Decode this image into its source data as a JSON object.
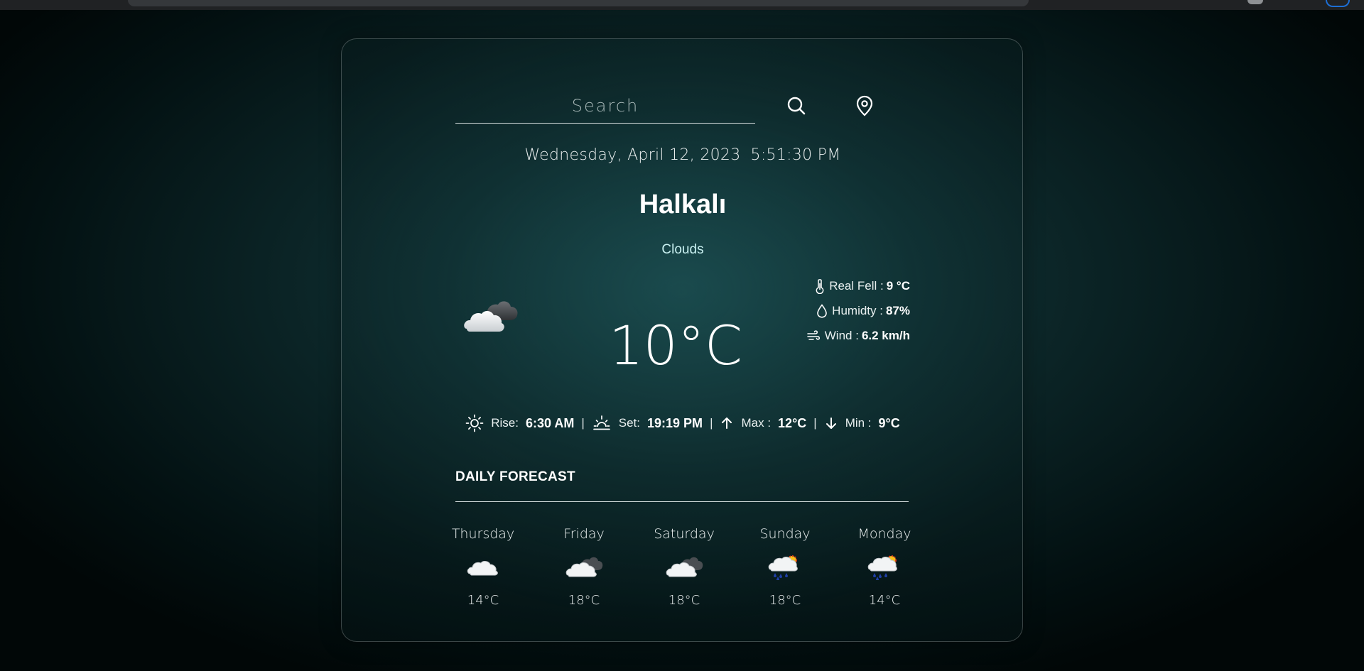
{
  "search": {
    "placeholder": "Search"
  },
  "datetime": {
    "date": "Wednesday, April 12, 2023",
    "time": "5:51:30 PM"
  },
  "location": {
    "city": "Halkalı"
  },
  "current": {
    "condition": "Clouds",
    "icon": "clouds-icon",
    "temperature": "10°C",
    "real_feel_label": "Real Fell :",
    "real_feel_value": "9 °C",
    "humidity_label": "Humidty :",
    "humidity_value": "87%",
    "wind_label": "Wind :",
    "wind_value": "6.2 km/h"
  },
  "sun": {
    "rise_label": "Rise:",
    "rise_value": "6:30 AM",
    "set_label": "Set:",
    "set_value": "19:19 PM",
    "max_label": "Max :",
    "max_value": "12°C",
    "min_label": "Min :",
    "min_value": "9°C",
    "separator": "|"
  },
  "forecast": {
    "title": "DAILY FORECAST",
    "days": [
      {
        "name": "Thursday",
        "temp": "14°C",
        "icon": "few-clouds-icon"
      },
      {
        "name": "Friday",
        "temp": "18°C",
        "icon": "broken-clouds-icon"
      },
      {
        "name": "Saturday",
        "temp": "18°C",
        "icon": "broken-clouds-icon"
      },
      {
        "name": "Sunday",
        "temp": "18°C",
        "icon": "rain-sun-icon"
      },
      {
        "name": "Monday",
        "temp": "14°C",
        "icon": "rain-sun-icon"
      }
    ]
  },
  "colors": {
    "background_center": "#164448",
    "background_edge": "#010707",
    "accent_condition": "#c9f1f1",
    "text": "#ffffff"
  }
}
